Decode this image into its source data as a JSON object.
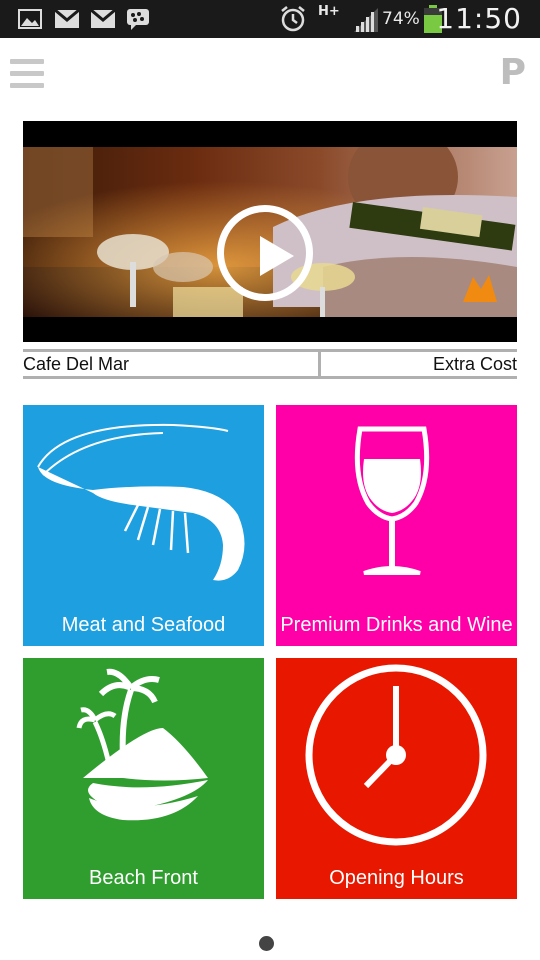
{
  "statusbar": {
    "battery": "74%",
    "network": "H+",
    "time": "11:50",
    "icons": [
      "image-icon",
      "gmail-icon",
      "gmail-icon",
      "bbm-icon",
      "alarm-icon",
      "signal-icon",
      "battery-icon"
    ]
  },
  "appbar": {
    "menu_icon": "hamburger-icon",
    "logo": "P"
  },
  "video": {
    "icon": "play-icon"
  },
  "info": {
    "title": "Cafe Del Mar",
    "cost": "Extra Cost"
  },
  "tiles": [
    {
      "label": "Meat and Seafood",
      "color": "#1e9fe0",
      "icon": "shrimp-icon"
    },
    {
      "label": "Premium Drinks and Wine",
      "color": "#ff00a8",
      "icon": "wine-glass-icon"
    },
    {
      "label": "Beach Front",
      "color": "#2f9e2f",
      "icon": "island-icon"
    },
    {
      "label": "Opening Hours",
      "color": "#e81700",
      "icon": "clock-icon"
    }
  ]
}
